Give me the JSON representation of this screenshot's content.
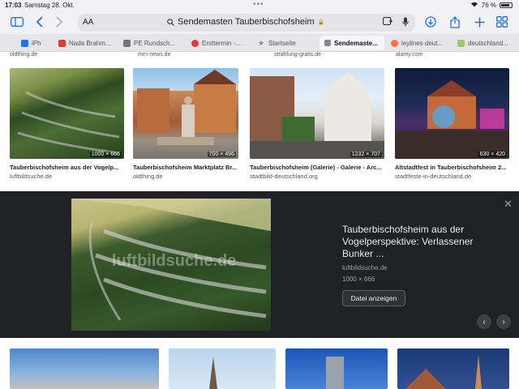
{
  "status": {
    "time": "17:03",
    "date": "Samstag 28. Okt.",
    "battery": "76 %"
  },
  "toolbar": {
    "text_size": "AA",
    "query": "Sendemasten Tauberbischofsheim"
  },
  "tabs": [
    {
      "label": "iPh",
      "color": "#1877f2"
    },
    {
      "label": "Nada Brahm...",
      "color": "#e53935"
    },
    {
      "label": "PE Rundsch...",
      "color": "#777777"
    },
    {
      "label": "Ersttermin -...",
      "color": "#e53935"
    },
    {
      "label": "Startseite",
      "color": "#888888"
    },
    {
      "label": "Sendemaste...",
      "color": "#555555"
    },
    {
      "label": "leylines deut...",
      "color": "#ff7043"
    },
    {
      "label": "deutschland...",
      "color": "#9ccc65"
    }
  ],
  "top_sources": [
    "oldthing.de",
    "mrn-news.de",
    "strahlung-gratis.de",
    "alamy.com"
  ],
  "results": [
    {
      "title": "Tauberbischofsheim aus der Vogelp...",
      "source": "luftbildsuche.de",
      "dims": "1000 × 666"
    },
    {
      "title": "Tauberbischofsheim Marktplatz Br...",
      "source": "oldthing.de",
      "dims": "700 × 496"
    },
    {
      "title": "Tauberbischofsheim (Galerie) - Galerie - Arc...",
      "source": "stadtbild-deutschland.org",
      "dims": "1232 × 707"
    },
    {
      "title": "Altstadtfest in Tauberbischofsheim 2...",
      "source": "stadtfeste-in-deutschland.de",
      "dims": "630 × 420"
    }
  ],
  "preview": {
    "title": "Tauberbischofsheim aus der Vogelperspektive: Verlassener Bunker ...",
    "source": "luftbildsuche.de",
    "dims": "1000 × 666",
    "button": "Datei anzeigen",
    "watermark": "luftbildsuche.de"
  }
}
